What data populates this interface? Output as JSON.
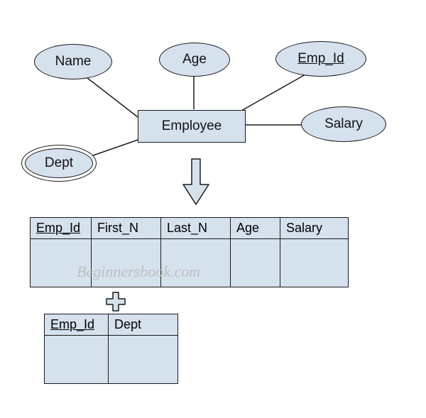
{
  "er": {
    "entity": "Employee",
    "attributes": {
      "name": "Name",
      "age": "Age",
      "emp_id": "Emp_Id",
      "salary": "Salary",
      "dept": "Dept"
    }
  },
  "tables": {
    "employee": {
      "columns": [
        "Emp_Id",
        "First_N",
        "Last_N",
        "Age",
        "Salary"
      ]
    },
    "dept": {
      "columns": [
        "Emp_Id",
        "Dept"
      ]
    }
  },
  "watermark": "Beginnersbook.com",
  "colors": {
    "fill": "#d6e1ee",
    "stroke": "#1a1a1a"
  }
}
